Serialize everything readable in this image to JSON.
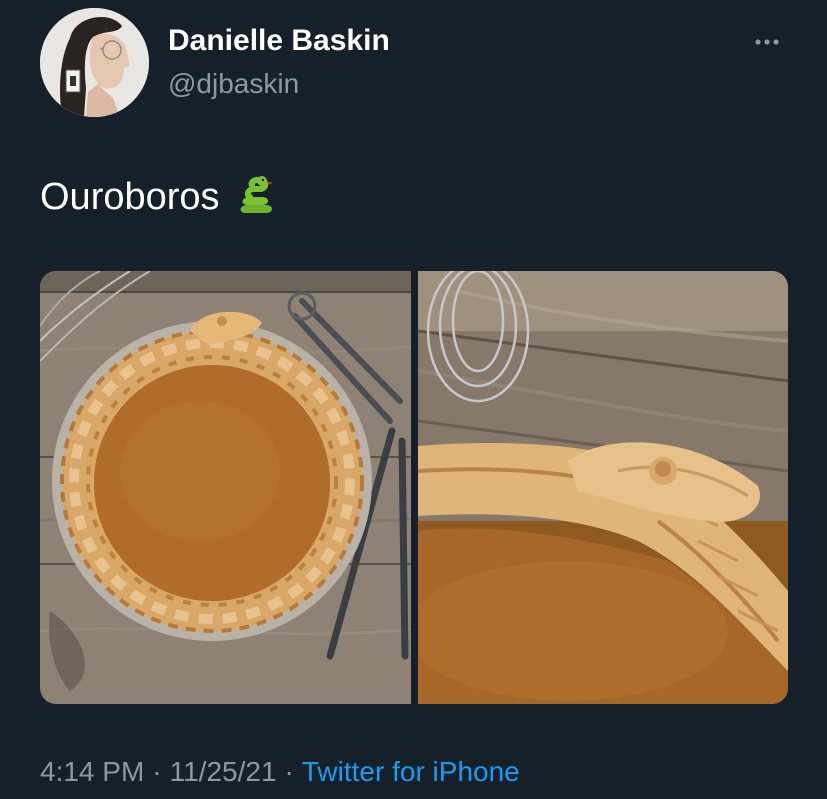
{
  "author": {
    "display_name": "Danielle Baskin",
    "handle": "@djbaskin",
    "avatar_icon": "profile-photo"
  },
  "tweet": {
    "text": "Ouroboros",
    "emoji": "snake-emoji"
  },
  "media": [
    {
      "name": "photo-1",
      "description_icon": "pie-photo"
    },
    {
      "name": "photo-2",
      "description_icon": "pie-closeup-photo"
    }
  ],
  "meta": {
    "time": "4:14 PM",
    "separator": "·",
    "date": "11/25/21",
    "source": "Twitter for iPhone"
  },
  "colors": {
    "background": "#15202b",
    "primary_text": "#ffffff",
    "secondary_text": "#8b98a5",
    "link": "#1d9bf0"
  }
}
